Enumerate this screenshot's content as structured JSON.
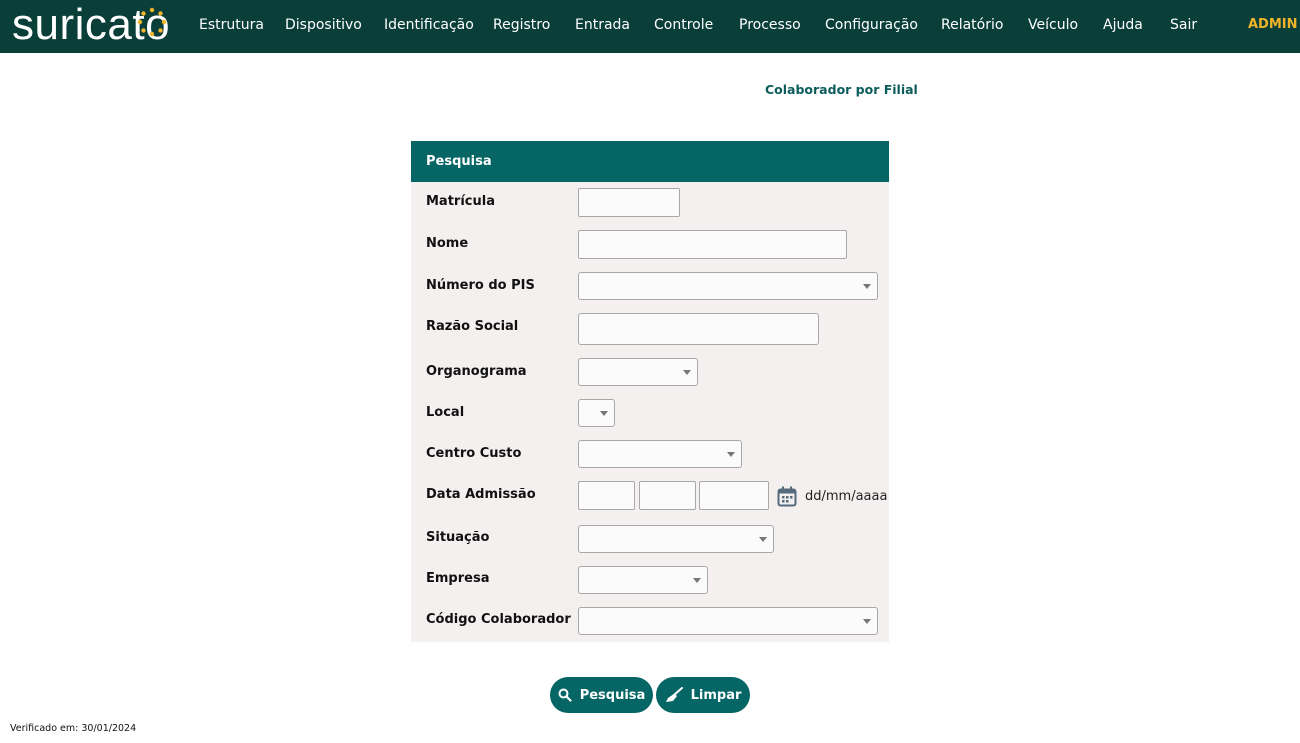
{
  "brand": {
    "logo_text": "suricato"
  },
  "nav": {
    "items": [
      {
        "label": "Estrutura"
      },
      {
        "label": "Dispositivo"
      },
      {
        "label": "Identificação"
      },
      {
        "label": "Registro"
      },
      {
        "label": "Entrada"
      },
      {
        "label": "Controle"
      },
      {
        "label": "Processo"
      },
      {
        "label": "Configuração"
      },
      {
        "label": "Relatório"
      },
      {
        "label": "Veículo"
      },
      {
        "label": "Ajuda"
      },
      {
        "label": "Sair"
      }
    ],
    "user": "ADMIN"
  },
  "page": {
    "title": "Colaborador por Filial"
  },
  "form": {
    "header": "Pesquisa",
    "fields": {
      "matricula": {
        "label": "Matrícula",
        "value": ""
      },
      "nome": {
        "label": "Nome",
        "value": ""
      },
      "pis": {
        "label": "Número do PIS",
        "value": ""
      },
      "razao_social": {
        "label": "Razão Social",
        "value": ""
      },
      "organograma": {
        "label": "Organograma",
        "value": ""
      },
      "local": {
        "label": "Local",
        "value": ""
      },
      "centro_custo": {
        "label": "Centro Custo",
        "value": ""
      },
      "data_admissao": {
        "label": "Data Admissão",
        "day": "",
        "month": "",
        "year": "",
        "format_hint": "dd/mm/aaaa"
      },
      "situacao": {
        "label": "Situação",
        "value": ""
      },
      "empresa": {
        "label": "Empresa",
        "value": ""
      },
      "codigo_colaborador": {
        "label": "Código Colaborador",
        "value": ""
      }
    }
  },
  "buttons": {
    "search": "Pesquisa",
    "clear": "Limpar"
  },
  "footer": {
    "verified": "Verificado em: 30/01/2024"
  },
  "colors": {
    "topbar": "#0a3e39",
    "accent": "#066565",
    "admin": "#f0b429",
    "panel_bg": "#f4f0ef"
  },
  "icons": {
    "logo_mark": "sun-dots-icon",
    "calendar": "calendar-icon",
    "search": "search-icon",
    "clear": "broom-icon",
    "dropdown": "chevron-down-icon"
  }
}
